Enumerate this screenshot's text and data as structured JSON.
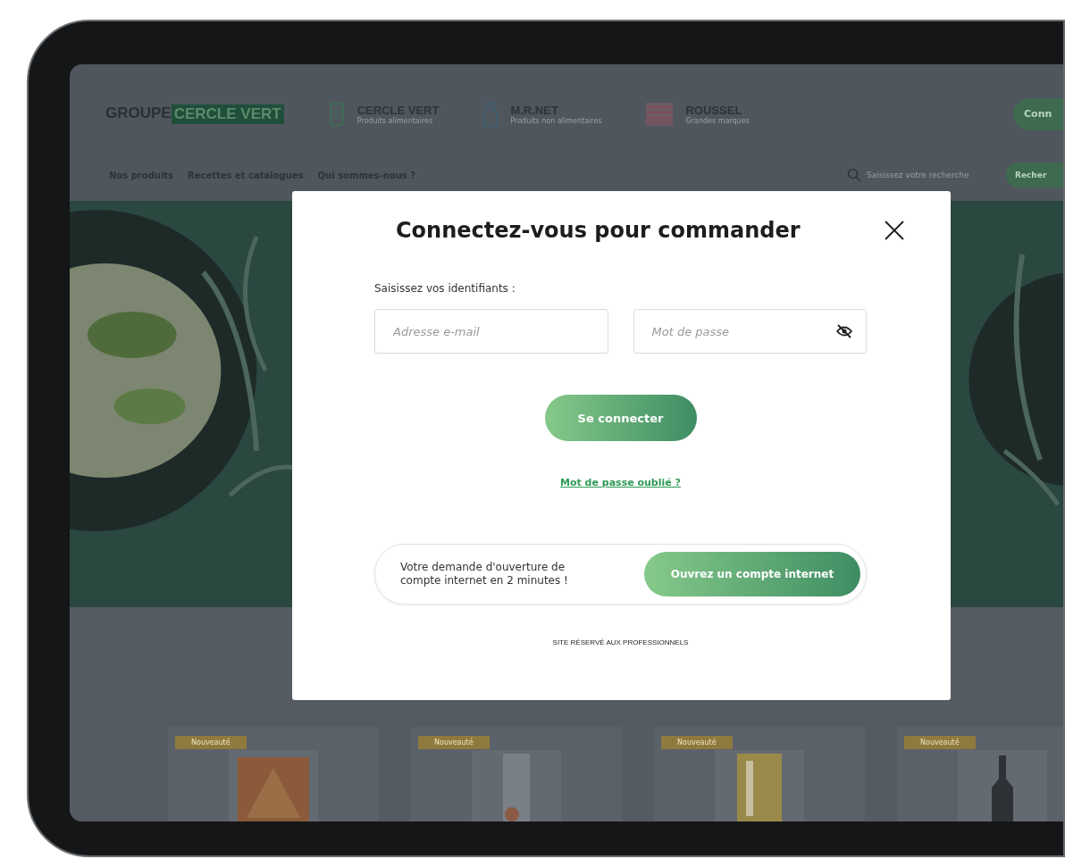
{
  "logo": {
    "prefix": "GROUPE",
    "highlight": "CERCLE VERT"
  },
  "brands": [
    {
      "kind": "jar",
      "name": "CERCLE VERT",
      "subtitle": "Produits alimentaires"
    },
    {
      "kind": "bottle",
      "name": "M.R.NET",
      "subtitle": "Produits non alimentaires"
    },
    {
      "kind": "flag",
      "name": "ROUSSEL",
      "subtitle": "Grandes marques"
    }
  ],
  "header_button": "Conn",
  "nav": [
    {
      "label": "Nos produits"
    },
    {
      "label": "Recettes et catalogues"
    },
    {
      "label": "Qui sommes-nous ?"
    }
  ],
  "search": {
    "placeholder": "Saisissez votre recherche",
    "button": "Recher"
  },
  "modal": {
    "title": "Connectez-vous pour commander",
    "prompt": "Saisissez vos identifiants :",
    "email_placeholder": "Adresse e-mail",
    "password_placeholder": "Mot de passe",
    "password_hidden": true,
    "submit": "Se connecter",
    "forgot": "Mot de passe oublié ?",
    "signup_text": "Votre demande d'ouverture de compte internet en 2 minutes !",
    "signup_button": "Ouvrez un compte internet",
    "footer": "SITE RÉSERVÉ AUX PROFESSIONNELS"
  },
  "products": [
    {
      "badge": "Nouveauté"
    },
    {
      "badge": "Nouveauté"
    },
    {
      "badge": "Nouveauté"
    },
    {
      "badge": "Nouveauté"
    }
  ]
}
